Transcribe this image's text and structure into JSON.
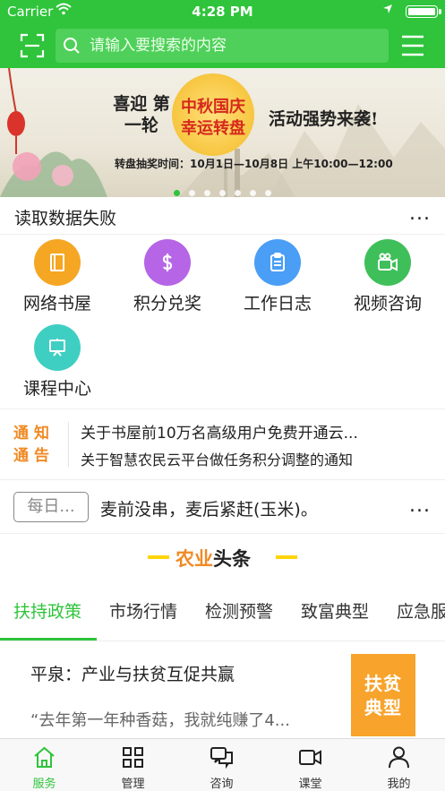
{
  "status_bar": {
    "carrier": "Carrier",
    "time": "4:28 PM"
  },
  "header": {
    "search_placeholder": "请输入要搜索的内容",
    "scan_icon": "scan-icon",
    "menu_icon": "hamburger-menu-icon",
    "brand_color": "#2fc43b"
  },
  "banner": {
    "left_text": "喜迎 第一轮",
    "medal_text": "中秋国庆 幸运转盘",
    "right_text": "活动强势来袭!",
    "schedule_text": "转盘抽奖时间：10月1日—10月8日 上午10:00—12:00",
    "slide_count": 7,
    "active_slide": 1
  },
  "notice_row": {
    "text": "读取数据失败",
    "more": "..."
  },
  "grid": [
    {
      "label": "网络书屋",
      "icon": "book-icon",
      "color": "#f5a623"
    },
    {
      "label": "积分兑奖",
      "icon": "dollar-icon",
      "color": "#b565e6"
    },
    {
      "label": "工作日志",
      "icon": "clipboard-icon",
      "color": "#4a9ef5"
    },
    {
      "label": "视频咨询",
      "icon": "video-camera-icon",
      "color": "#3fbf5a"
    },
    {
      "label": "课程中心",
      "icon": "presentation-board-icon",
      "color": "#3fcfc2"
    }
  ],
  "announcements": {
    "tag": "通知通告",
    "tag_line1": "通知",
    "tag_line2": "通告",
    "items": [
      "关于书屋前10万名高级用户免费开通云...",
      "关于智慧农民云平台做任务积分调整的通知"
    ]
  },
  "daily": {
    "badge": "每日...",
    "tip": "麦前没串，麦后紧赶(玉米)。",
    "more": "..."
  },
  "section": {
    "accent": "农业",
    "plain": "头条"
  },
  "tabs": [
    {
      "label": "扶持政策",
      "active": true
    },
    {
      "label": "市场行情",
      "active": false
    },
    {
      "label": "检测预警",
      "active": false
    },
    {
      "label": "致富典型",
      "active": false
    },
    {
      "label": "应急服",
      "active": false
    }
  ],
  "article": {
    "headline": "平泉：产业与扶贫互促共赢",
    "excerpt": "“去年第一年种香菇，我就纯赚了4...",
    "tag_line1": "扶贫",
    "tag_line2": "典型"
  },
  "tabbar": [
    {
      "label": "服务",
      "icon": "home-icon",
      "active": true
    },
    {
      "label": "管理",
      "icon": "grid-squares-icon",
      "active": false
    },
    {
      "label": "咨询",
      "icon": "chat-bubbles-icon",
      "active": false
    },
    {
      "label": "课堂",
      "icon": "video-camera-icon",
      "active": false
    },
    {
      "label": "我的",
      "icon": "user-icon",
      "active": false
    }
  ]
}
